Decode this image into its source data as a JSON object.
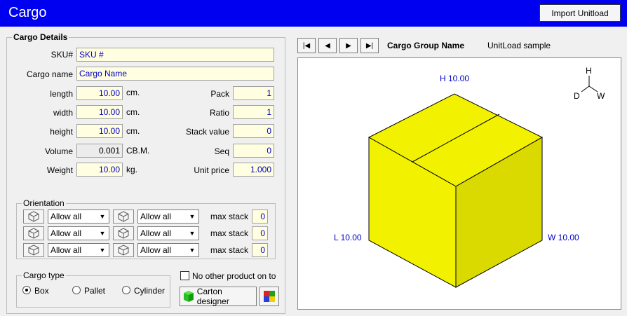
{
  "window": {
    "title": "Cargo",
    "import_button": "Import Unitload"
  },
  "details": {
    "legend": "Cargo Details",
    "sku_label": "SKU#",
    "sku_value": "SKU #",
    "name_label": "Cargo name",
    "name_value": "Cargo Name",
    "length_label": "length",
    "length_value": "10.00",
    "length_unit": "cm.",
    "width_label": "width",
    "width_value": "10.00",
    "width_unit": "cm.",
    "height_label": "height",
    "height_value": "10.00",
    "height_unit": "cm.",
    "volume_label": "Volume",
    "volume_value": "0.001",
    "volume_unit": "CB.M.",
    "weight_label": "Weight",
    "weight_value": "10.00",
    "weight_unit": "kg.",
    "pack_label": "Pack",
    "pack_value": "1",
    "ratio_label": "Ratio",
    "ratio_value": "1",
    "stack_label": "Stack value",
    "stack_value": "0",
    "seq_label": "Seq",
    "seq_value": "0",
    "price_label": "Unit price",
    "price_value": "1.000"
  },
  "orientation": {
    "legend": "Orientation",
    "rows": [
      {
        "left_select": "Allow all",
        "right_select": "Allow all",
        "max_label": "max stack",
        "max_value": "0"
      },
      {
        "left_select": "Allow all",
        "right_select": "Allow all",
        "max_label": "max stack",
        "max_value": "0"
      },
      {
        "left_select": "Allow all",
        "right_select": "Allow all",
        "max_label": "max stack",
        "max_value": "0"
      }
    ]
  },
  "cargo_type": {
    "legend": "Cargo type",
    "options": [
      "Box",
      "Pallet",
      "Cylinder"
    ],
    "selected": "Box"
  },
  "no_other_label": "No other product on to",
  "carton_designer_label": "Carton designer",
  "group": {
    "label": "Cargo Group Name",
    "value": "UnitLoad sample"
  },
  "preview": {
    "height_label": "H 10.00",
    "length_label": "L 10.00",
    "width_label": "W 10.00",
    "axis": {
      "h": "H",
      "d": "D",
      "w": "W"
    },
    "box_color": "#f2f200"
  },
  "colors": {
    "titlebar": "#0000f0",
    "field_bg": "#fffee0",
    "field_text": "#0000c8"
  },
  "icons": [
    "first-record-icon",
    "prev-record-icon",
    "next-record-icon",
    "last-record-icon",
    "box-orientation-icon",
    "green-box-icon",
    "color-palette-icon"
  ]
}
